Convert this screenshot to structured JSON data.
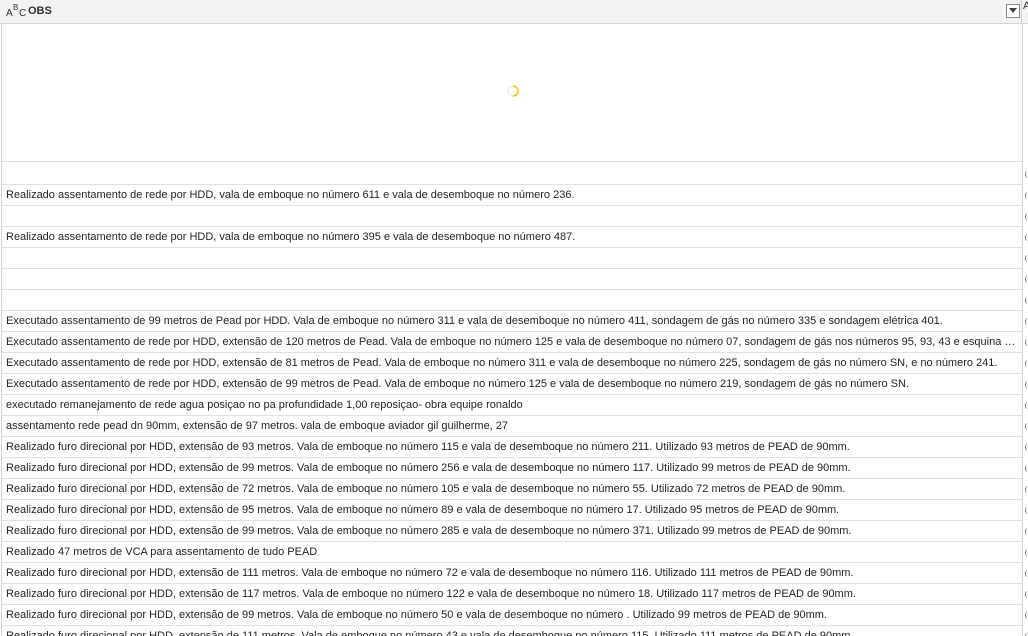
{
  "column": {
    "type_icon": "text-type-icon",
    "type_letters": [
      "A",
      "B",
      "C"
    ],
    "title": "OBS",
    "filter_icon": "dropdown-arrow-icon",
    "next_column_partial": "A"
  },
  "loading": {
    "spinner_icon": "loading-spinner-icon"
  },
  "rows": [
    "",
    "Realizado assentamento de rede por HDD, vala de emboque no número 611 e vala de desemboque no número 236.",
    "",
    "Realizado assentamento de rede por HDD, vala de emboque no número 395 e vala de desemboque no número 487.",
    "",
    "",
    "",
    "Executado assentamento de 99 metros de Pead por HDD. Vala de emboque no número 311 e vala de desemboque no número 411, sondagem de gás no número 335 e sondagem elétrica 401.",
    "Executado assentamento de rede por HDD, extensão de 120 metros de Pead. Vala de emboque no número 125 e vala de desemboque no número 07, sondagem de gás nos números 95, 93, 43 e esquina co...",
    "Executado assentamento de rede por HDD, extensão de 81 metros de Pead. Vala de emboque no número 311 e vala de desemboque no número 225, sondagem de gás no número SN, e no número 241.",
    "Executado assentamento de rede por HDD, extensão de 99 metros de Pead. Vala de emboque no número 125 e vala de desemboque no número 219, sondagem de gás no número SN.",
    "executado remanejamento de rede agua posiçao no pa profundidade 1,00 reposiçao- obra equipe ronaldo",
    "assentamento rede pead dn 90mm, extensão de 97 metros. vala de emboque aviador gil guilherme, 27",
    "Realizado furo direcional por HDD, extensão de 93 metros. Vala de emboque no número 115 e vala de desemboque no número 211. Utilizado 93 metros de PEAD de 90mm.",
    "Realizado furo direcional por HDD, extensão de 99 metros. Vala de emboque no número 256 e vala de desemboque no número 117. Utilizado 99 metros de PEAD de 90mm.",
    "Realizado furo direcional por HDD, extensão de 72 metros. Vala de emboque no número 105 e vala de desemboque no número 55. Utilizado 72 metros de PEAD de 90mm.",
    "Realizado furo direcional por HDD, extensão de 95 metros. Vala de emboque no número 89 e vala de desemboque no número 17. Utilizado 95 metros de PEAD de 90mm.",
    "Realizado furo direcional por HDD, extensão de 99 metros. Vala de emboque no número 285 e vala de desemboque no número 371. Utilizado 99 metros de PEAD de 90mm.",
    "Realizado 47 metros de VCA para assentamento de tudo PEAD",
    "Realizado furo direcional por HDD, extensão de 111 metros. Vala de emboque no número 72 e vala de desemboque no número 116. Utilizado 111 metros de PEAD de 90mm.",
    "Realizado furo direcional por HDD, extensão de 117 metros. Vala de emboque no número 122 e vala de desemboque no número 18. Utilizado 117 metros de PEAD de 90mm.",
    "Realizado furo direcional por HDD, extensão de 99 metros. Vala de emboque no número 50 e vala de desemboque no número . Utilizado 99 metros de PEAD de 90mm.",
    "Realizado furo direcional por HDD, extensão de 111 metros. Vala de emboque no número 43 e vala de desemboque no número 115. Utilizado 111 metros de PEAD de 90mm."
  ]
}
